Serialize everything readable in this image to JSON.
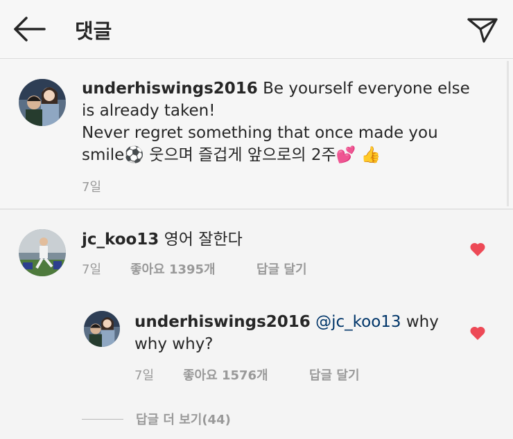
{
  "header": {
    "title": "댓글",
    "back_icon": "back-arrow-icon",
    "send_icon": "paper-plane-icon"
  },
  "caption": {
    "username": "underhiswings2016",
    "text_line1": "Be yourself everyone else",
    "text_line2": "is already taken!",
    "text_line3": "Never regret something that once made you",
    "text_line4a": "smile",
    "soccer_emoji": "⚽",
    "text_line4b": "웃으며 즐겁게 앞으로의 2주",
    "hearts_emoji": "💕",
    "thumbs_emoji": "👍",
    "time": "7일"
  },
  "comments": [
    {
      "username": "jc_koo13",
      "text": "영어 잘한다",
      "time": "7일",
      "likes": "좋아요 1395개",
      "reply": "답글 달기",
      "liked": true,
      "heart_color": "#ed4956"
    },
    {
      "username": "underhiswings2016",
      "mention": "@jc_koo13",
      "text_a": "why",
      "text_b": "why why?",
      "time": "7일",
      "likes": "좋아요 1576개",
      "reply": "답글 달기",
      "liked": true,
      "heart_color": "#ed4956"
    }
  ],
  "view_replies": {
    "label": "답글 더 보기(44)"
  }
}
